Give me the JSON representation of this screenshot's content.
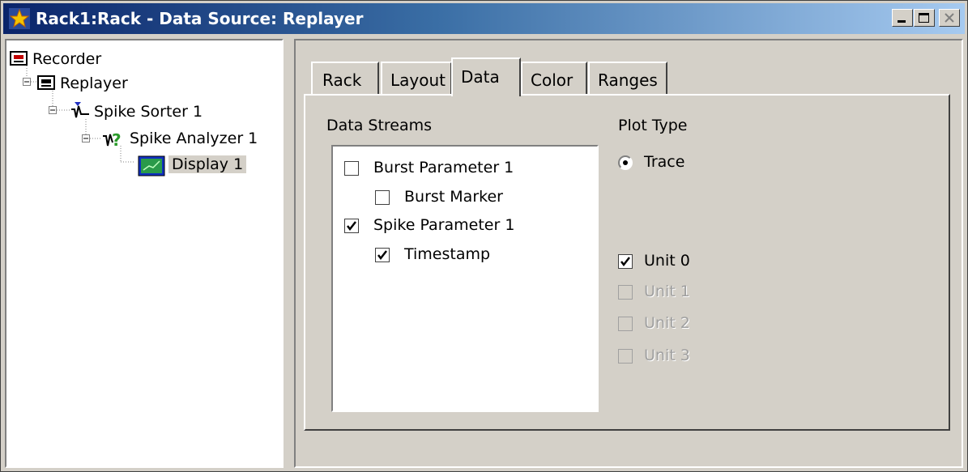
{
  "window": {
    "title": "Rack1:Rack - Data Source: Replayer"
  },
  "tree": {
    "items": [
      {
        "label": "Recorder",
        "icon": "recorder-icon"
      },
      {
        "label": "Replayer",
        "icon": "replayer-icon"
      },
      {
        "label": "Spike Sorter 1",
        "icon": "spike-sorter-icon"
      },
      {
        "label": "Spike Analyzer 1",
        "icon": "spike-analyzer-icon"
      },
      {
        "label": "Display 1",
        "icon": "display-icon",
        "selected": true
      }
    ]
  },
  "tabs": [
    {
      "label": "Rack"
    },
    {
      "label": "Layout"
    },
    {
      "label": "Data",
      "active": true
    },
    {
      "label": "Color"
    },
    {
      "label": "Ranges"
    }
  ],
  "data_tab": {
    "streams_label": "Data Streams",
    "streams": [
      {
        "label": "Burst Parameter 1",
        "checked": false
      },
      {
        "label": "Burst Marker",
        "checked": false
      },
      {
        "label": "Spike Parameter 1",
        "checked": true
      },
      {
        "label": "Timestamp",
        "checked": true
      }
    ],
    "plot_type_label": "Plot Type",
    "plot_type_option": "Trace",
    "units": [
      {
        "label": "Unit 0",
        "checked": true,
        "enabled": true
      },
      {
        "label": "Unit 1",
        "checked": false,
        "enabled": false
      },
      {
        "label": "Unit 2",
        "checked": false,
        "enabled": false
      },
      {
        "label": "Unit 3",
        "checked": false,
        "enabled": false
      }
    ]
  }
}
